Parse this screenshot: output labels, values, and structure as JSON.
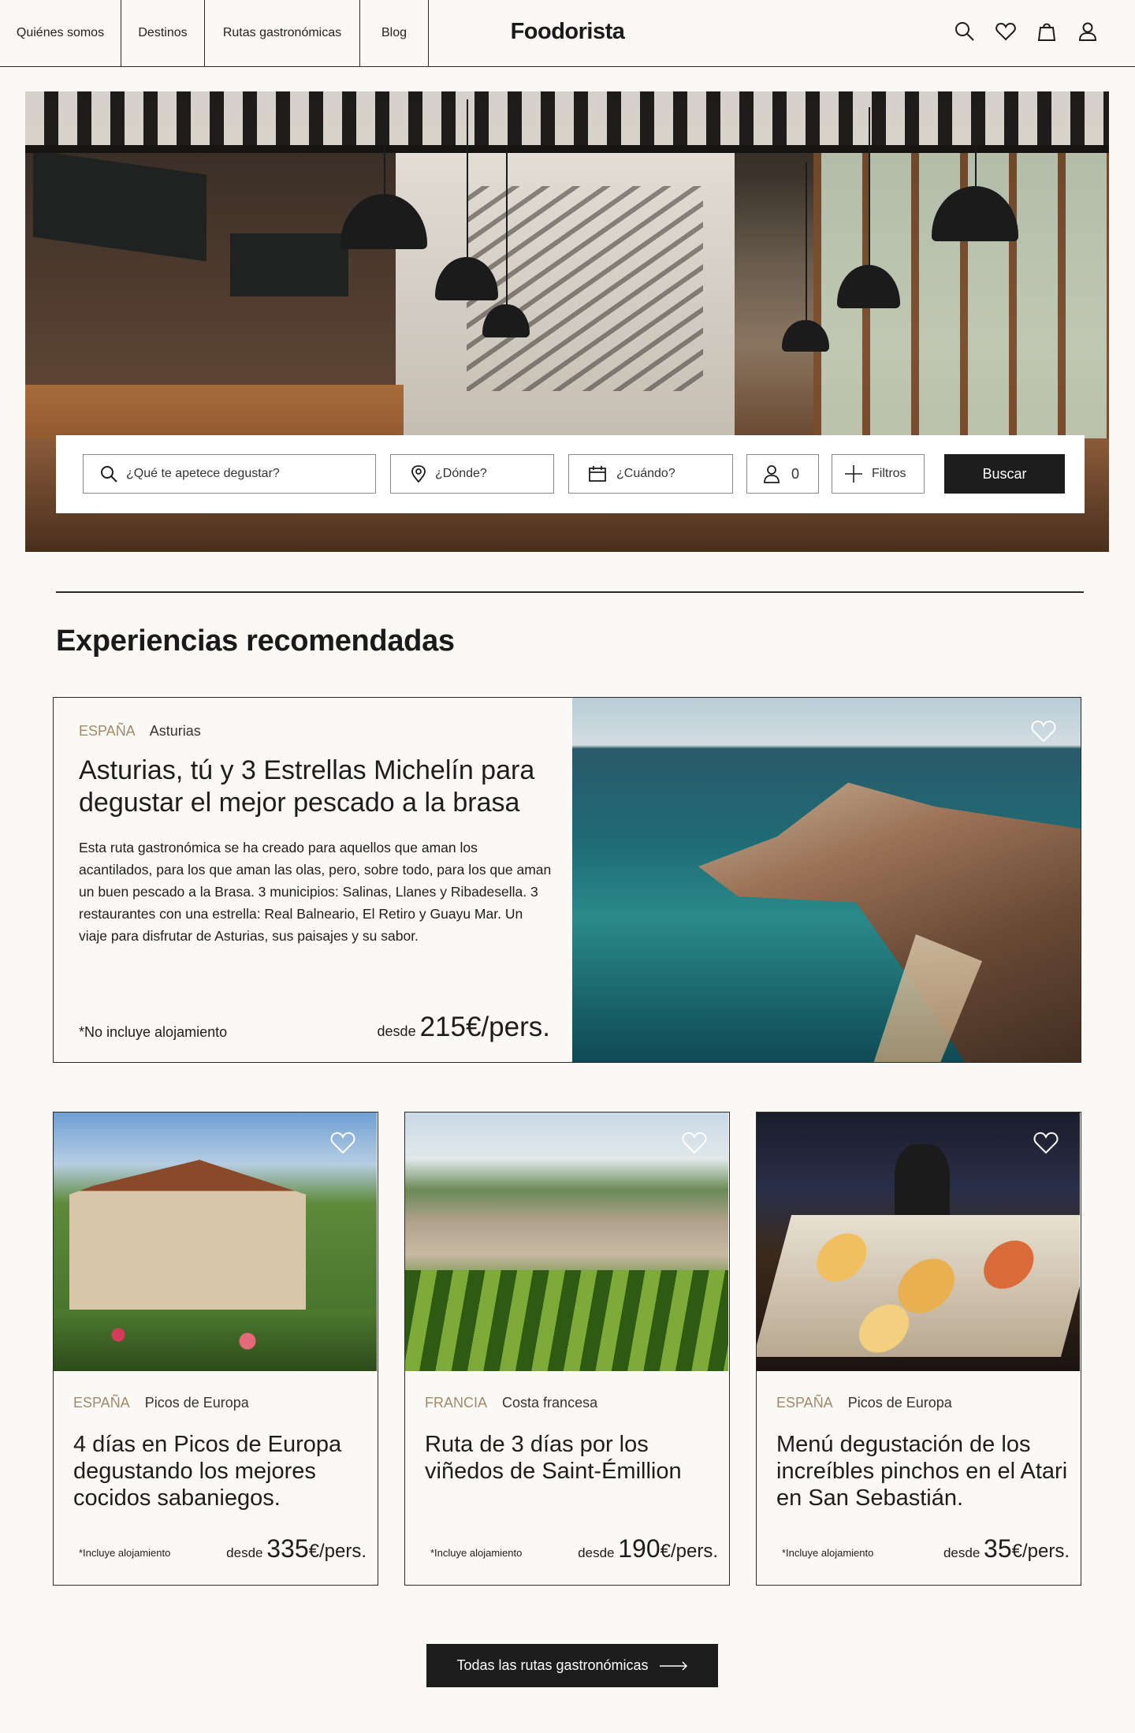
{
  "header": {
    "nav": [
      "Quiénes somos",
      "Destinos",
      "Rutas gastronómicas",
      "Blog"
    ],
    "logo": "Foodorista",
    "icons": [
      "search-icon",
      "heart-icon",
      "bag-icon",
      "user-icon"
    ]
  },
  "search": {
    "what_placeholder": "¿Qué te apetece degustar?",
    "where_placeholder": "¿Dónde?",
    "when_placeholder": "¿Cuándo?",
    "people_count": "0",
    "filters_label": "Filtros",
    "button_label": "Buscar"
  },
  "section": {
    "title": "Experiencias recomendadas"
  },
  "featured": {
    "country": "ESPAÑA",
    "region": "Asturias",
    "title": "Asturias, tú y 3 Estrellas Michelín para degustar el mejor pescado a la brasa",
    "description": "Esta ruta gastronómica se ha creado para aquellos que aman los acantilados, para los que aman las olas, pero, sobre todo, para los que aman un buen pescado a la Brasa. 3 municipios: Salinas, Llanes y Ribadesella. 3 restaurantes con una estrella: Real Balneario, El Retiro y Guayu Mar. Un viaje para disfrutar de Asturias, sus paisajes y su sabor.",
    "note": "*No incluye alojamiento",
    "price_prefix": "desde",
    "price": "215€/pers."
  },
  "cards": [
    {
      "country": "ESPAÑA",
      "region": "Picos de Europa",
      "title": "4 días en Picos de Europa degustando los mejores cocidos sabaniegos.",
      "note": "*Incluye alojamiento",
      "price_prefix": "desde",
      "price_num": "335",
      "price_unit": "€/pers."
    },
    {
      "country": "FRANCIA",
      "region": "Costa francesa",
      "title": "Ruta de 3 días por los viñedos de Saint-Émillion",
      "note": "*Incluye alojamiento",
      "price_prefix": "desde",
      "price_num": "190",
      "price_unit": "€/pers."
    },
    {
      "country": "ESPAÑA",
      "region": "Picos de Europa",
      "title": "Menú degustación de los increíbles pinchos en el Atari en San Sebastián.",
      "note": "*Incluye alojamiento",
      "price_prefix": "desde",
      "price_num": "35",
      "price_unit": "€/pers."
    }
  ],
  "cta": {
    "label": "Todas las rutas gastronómicas"
  },
  "colors": {
    "background": "#fbf9f5",
    "dark": "#1d1d1d",
    "country_accent": "#a08a6a"
  }
}
